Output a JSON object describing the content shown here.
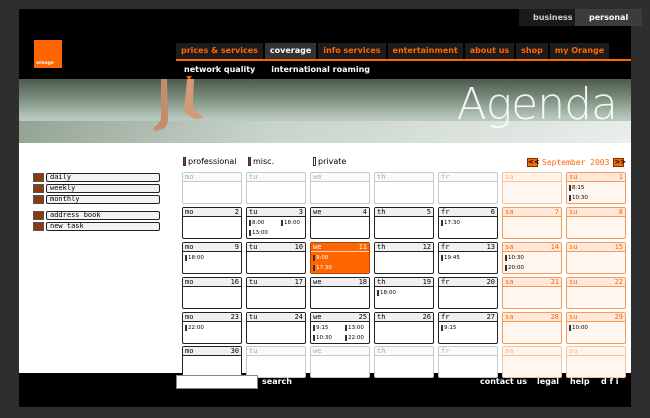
{
  "top_tabs": [
    "business",
    "personal"
  ],
  "logo_text": "orange",
  "main_nav": [
    "prices & services",
    "coverage",
    "info services",
    "entertainment",
    "about us",
    "shop",
    "my Orange"
  ],
  "sub_nav": [
    "network quality",
    "international roaming"
  ],
  "banner_title": "Agenda",
  "left_links": [
    "daily",
    "weekly",
    "monthly",
    "address book",
    "new task"
  ],
  "legend": [
    {
      "label": "professional",
      "color": "#a43a00"
    },
    {
      "label": "misc.",
      "color": "#a43a00"
    },
    {
      "label": "private",
      "color": "#ffffff"
    }
  ],
  "month_label": "September 2003",
  "prev_arrow": "<<",
  "next_arrow": ">>",
  "weekdays": [
    "mo",
    "tu",
    "we",
    "th",
    "fr",
    "sa",
    "su"
  ],
  "weeks": [
    [
      {
        "day": ""
      },
      {
        "day": ""
      },
      {
        "day": ""
      },
      {
        "day": ""
      },
      {
        "day": ""
      },
      {
        "day": ""
      },
      {
        "day": "1",
        "events": [
          "8:15",
          "10:30"
        ]
      }
    ],
    [
      {
        "day": "2"
      },
      {
        "day": "3",
        "events": [
          "8:00",
          "18:00",
          "13:00"
        ]
      },
      {
        "day": "4"
      },
      {
        "day": "5"
      },
      {
        "day": "6",
        "events": [
          "17:30"
        ]
      },
      {
        "day": "7"
      },
      {
        "day": "8"
      }
    ],
    [
      {
        "day": "9",
        "events": [
          "18:00"
        ]
      },
      {
        "day": "10"
      },
      {
        "day": "11",
        "events": [
          "9:00",
          "17:30"
        ]
      },
      {
        "day": "12"
      },
      {
        "day": "13",
        "events": [
          "19:45"
        ]
      },
      {
        "day": "14",
        "events": [
          "10:30",
          "20:00"
        ]
      },
      {
        "day": "15"
      }
    ],
    [
      {
        "day": "16"
      },
      {
        "day": "17"
      },
      {
        "day": "18"
      },
      {
        "day": "19",
        "events": [
          "18:00"
        ]
      },
      {
        "day": "20"
      },
      {
        "day": "21"
      },
      {
        "day": "22"
      }
    ],
    [
      {
        "day": "23",
        "events": [
          "22:00"
        ]
      },
      {
        "day": "24"
      },
      {
        "day": "25",
        "events": [
          "9:15",
          "13:00",
          "10:30",
          "22:00"
        ]
      },
      {
        "day": "26"
      },
      {
        "day": "27",
        "events": [
          "9:15"
        ]
      },
      {
        "day": "28"
      },
      {
        "day": "29",
        "events": [
          "10:00"
        ]
      }
    ],
    [
      {
        "day": "30"
      },
      {
        "day": ""
      },
      {
        "day": ""
      },
      {
        "day": ""
      },
      {
        "day": ""
      },
      {
        "day": ""
      },
      {
        "day": ""
      }
    ]
  ],
  "today": "11",
  "search": {
    "button": "search",
    "value": ""
  },
  "footer_links": [
    "contact us",
    "legal",
    "help"
  ],
  "footer_lang": "d f i",
  "colors": {
    "accent": "#ff6600"
  }
}
